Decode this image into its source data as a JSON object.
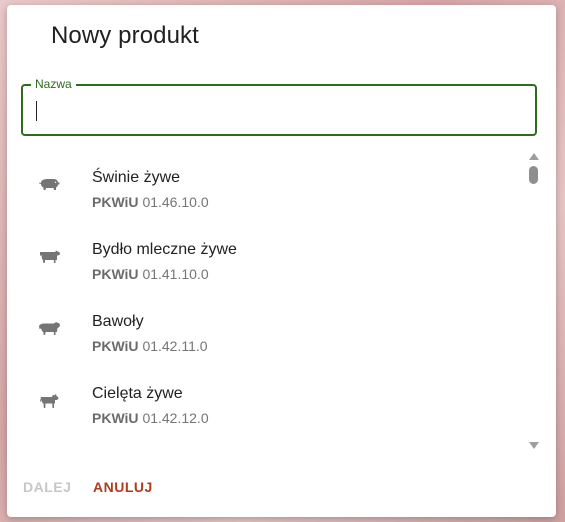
{
  "dialog": {
    "title": "Nowy produkt",
    "name_field": {
      "label": "Nazwa",
      "value": "",
      "placeholder": ""
    },
    "items": [
      {
        "name": "Świnie żywe",
        "code_label": "PKWiU",
        "code": "01.46.10.0",
        "icon": "pig-icon"
      },
      {
        "name": "Bydło mleczne żywe",
        "code_label": "PKWiU",
        "code": "01.41.10.0",
        "icon": "cow-icon"
      },
      {
        "name": "Bawoły",
        "code_label": "PKWiU",
        "code": "01.42.11.0",
        "icon": "buffalo-icon"
      },
      {
        "name": "Cielęta żywe",
        "code_label": "PKWiU",
        "code": "01.42.12.0",
        "icon": "calf-icon"
      }
    ],
    "actions": {
      "next_label": "DALEJ",
      "cancel_label": "ANULUJ"
    }
  },
  "colors": {
    "accent": "#2e6b1d",
    "cancel": "#b23a1e",
    "disabled": "#c7c7c7",
    "icon": "#757575"
  }
}
